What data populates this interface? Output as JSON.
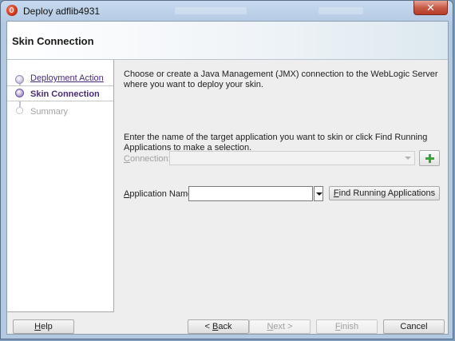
{
  "window": {
    "title": "Deploy adflib4931",
    "close_label": "✕"
  },
  "header": {
    "title": "Skin Connection"
  },
  "nav": {
    "items": [
      {
        "label": "Deployment Action",
        "state": "visited"
      },
      {
        "label": "Skin Connection",
        "state": "current"
      },
      {
        "label": "Summary",
        "state": "disabled"
      }
    ]
  },
  "content": {
    "intro": "Choose or create a Java Management (JMX) connection to the WebLogic Server where you want to deploy your skin.",
    "connection_label_prefix": "C",
    "connection_label_rest": "onnection:",
    "connection_value": "",
    "instruction": "Enter the name of the target application you want to skin or click Find Running Applications to make a selection.",
    "app_name_label_prefix": "A",
    "app_name_label_rest": "pplication Name:",
    "app_name_value": "",
    "find_button_prefix": "F",
    "find_button_rest": "ind Running Applications"
  },
  "footer": {
    "help_prefix": "H",
    "help_rest": "elp",
    "back_prefix": "< ",
    "back_mnemonic": "B",
    "back_rest": "ack",
    "next_prefix": "N",
    "next_rest": "ext >",
    "finish_prefix": "F",
    "finish_rest": "inish",
    "cancel": "Cancel"
  }
}
